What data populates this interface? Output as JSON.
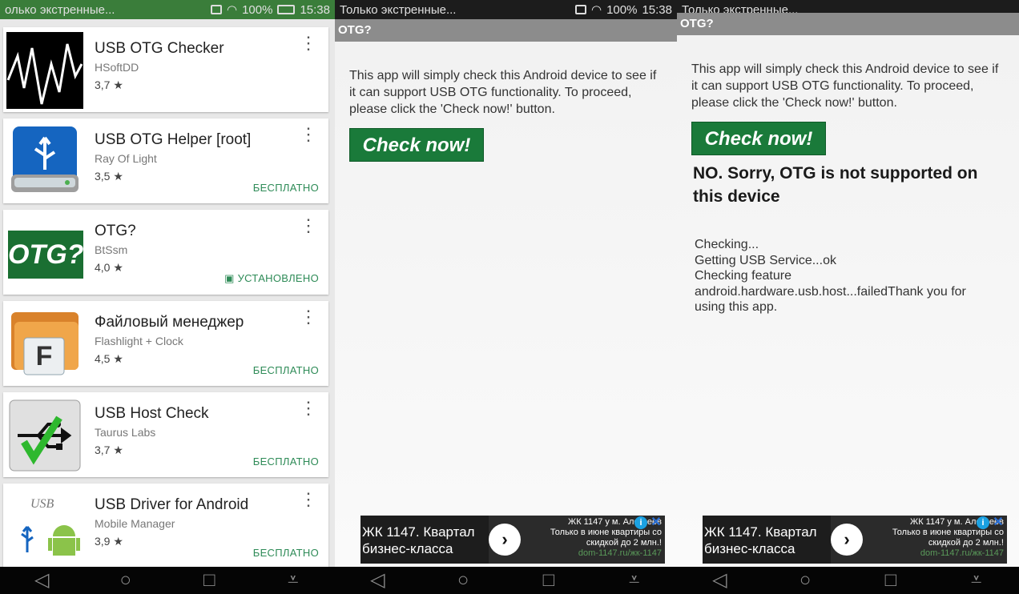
{
  "statusbar": {
    "p1_text": "олько экстренные...",
    "p1_right": "100%",
    "p1_time": "15:38",
    "p2_text": "Только экстренные...",
    "p2_right": "100%",
    "p2_time": "15:38",
    "p3_text": "Только экстренные..."
  },
  "apps": [
    {
      "title": "USB OTG Checker",
      "dev": "HSoftDD",
      "rating": "3,7 ★",
      "price": "",
      "icon": "waveform-icon"
    },
    {
      "title": "USB OTG Helper [root]",
      "dev": "Ray Of Light",
      "rating": "3,5 ★",
      "price": "БЕСПЛАТНО",
      "icon": "usb-drive-icon"
    },
    {
      "title": "OTG?",
      "dev": "BtSsm",
      "rating": "4,0 ★",
      "price": "УСТАНОВЛЕНО",
      "icon": "otg-logo-icon"
    },
    {
      "title": "Файловый менеджер",
      "dev": "Flashlight + Clock",
      "rating": "4,5 ★",
      "price": "БЕСПЛАТНО",
      "icon": "folder-icon"
    },
    {
      "title": "USB Host Check",
      "dev": "Taurus Labs",
      "rating": "3,7 ★",
      "price": "БЕСПЛАТНО",
      "icon": "usb-check-icon"
    },
    {
      "title": "USB Driver for Android",
      "dev": "Mobile Manager",
      "rating": "3,9 ★",
      "price": "БЕСПЛАТНО",
      "icon": "usb-android-icon"
    }
  ],
  "otg_logo_text": "OTG?",
  "file_icon_letter": "F",
  "app": {
    "title": "OTG?",
    "intro": "This app will simply check this Android device to see if it can support USB OTG functionality. To proceed, please click the 'Check now!' button.",
    "check_button": "Check now!",
    "result": "NO. Sorry, OTG is not supported on this device",
    "log": "Checking...\nGetting USB Service...ok\nChecking feature\nandroid.hardware.usb.host...failedThank you for\nusing this app."
  },
  "ad": {
    "headline": "ЖК 1147. Квартал бизнес-класса",
    "side_title": "ЖК 1147 у м. Алексеев",
    "side_text": "Только в июне квартиры со скидкой до 2 млн.!",
    "url": "dom-1147.ru/жк-1147"
  }
}
